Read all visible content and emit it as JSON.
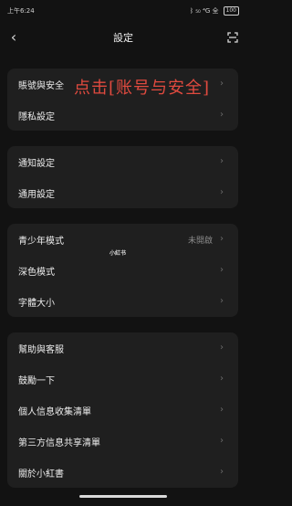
{
  "status_bar": {
    "time": "上午6:24",
    "signal_text": "ᛒ ₅₀ ⁴G 全",
    "battery_text": "100"
  },
  "header": {
    "title": "設定"
  },
  "annotation": {
    "text": "点击[账号与安全]"
  },
  "watermark": {
    "text": "小紅书"
  },
  "sections": [
    {
      "items": [
        {
          "label": "賬號與安全"
        },
        {
          "label": "隱私設定"
        }
      ]
    },
    {
      "items": [
        {
          "label": "通知設定"
        },
        {
          "label": "通用設定"
        }
      ]
    },
    {
      "items": [
        {
          "label": "青少年模式",
          "value": "未開啟"
        },
        {
          "label": "深色模式"
        },
        {
          "label": "字體大小"
        }
      ]
    },
    {
      "items": [
        {
          "label": "幫助與客服"
        },
        {
          "label": "鼓勵一下"
        },
        {
          "label": "個人信息收集清單"
        },
        {
          "label": "第三方信息共享清單"
        },
        {
          "label": "關於小紅書"
        }
      ]
    }
  ],
  "colors": {
    "background": "#121212",
    "card": "#1f1f1f",
    "annotation": "#e04a3f"
  }
}
